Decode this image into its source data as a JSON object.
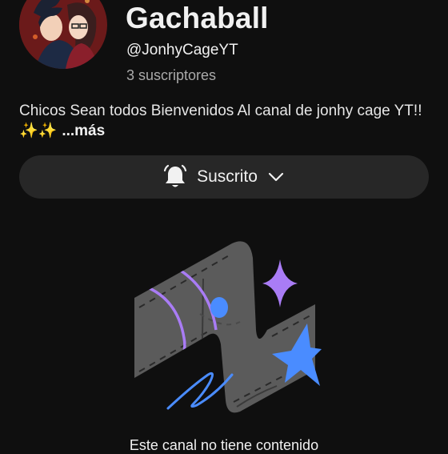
{
  "channel": {
    "name": "Gachaball",
    "handle": "@JonhyCageYT",
    "subscribers": "3 suscriptores",
    "description_line1": "Chicos Sean todos Bienvenidos Al canal de jonhy cage YT!!",
    "description_line2": "✨✨",
    "more_label": "...más"
  },
  "subscribe_button": {
    "label": "Suscrito",
    "bell_icon": "bell-icon",
    "chevron_icon": "chevron-down-icon"
  },
  "empty_state": {
    "message": "Este canal no tiene contenido"
  },
  "colors": {
    "background": "#0f0f0f",
    "button_bg": "#272727",
    "accent_purple": "#a97cf5",
    "accent_blue": "#4a8cff"
  }
}
